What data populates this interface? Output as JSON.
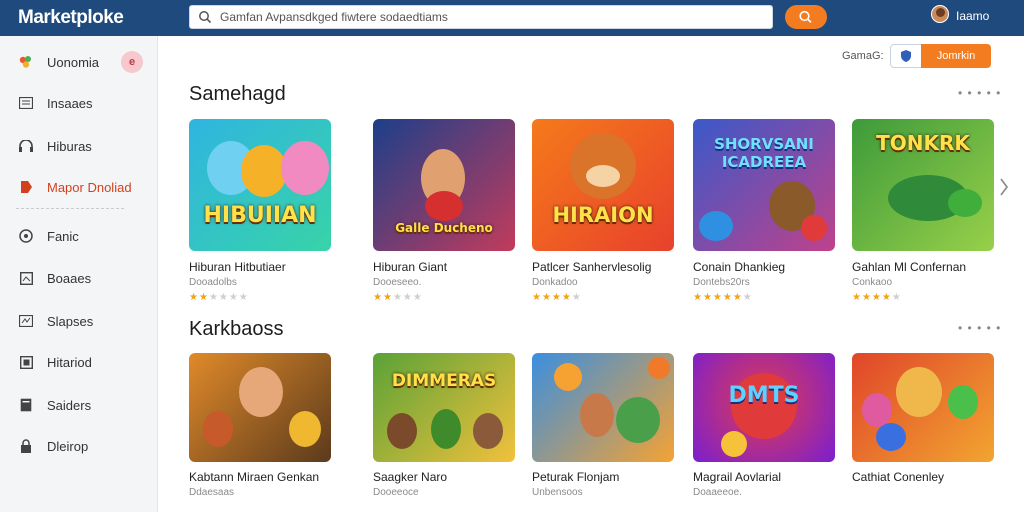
{
  "app": {
    "logo": "Marketploke"
  },
  "search": {
    "placeholder": "Gamfan Avpansdkged fiwtere sodaedtiams"
  },
  "user": {
    "name": "Iaamo"
  },
  "sidebar": {
    "items": [
      {
        "label": "Uonomia",
        "icon": "leaf-icon",
        "badge": "e"
      },
      {
        "label": "Insaaes",
        "icon": "list-icon"
      },
      {
        "label": "Hiburas",
        "icon": "headphones-icon"
      },
      {
        "label": "Mapor Dnoliad",
        "icon": "tag-icon",
        "active": true
      },
      {
        "label": "Fanic",
        "icon": "disc-icon"
      },
      {
        "label": "Boaaes",
        "icon": "box-icon"
      },
      {
        "label": "Slapses",
        "icon": "grid-icon"
      },
      {
        "label": "Hitariod",
        "icon": "square-icon"
      },
      {
        "label": "Saiders",
        "icon": "doc-icon"
      },
      {
        "label": "Dleirop",
        "icon": "lock-icon"
      }
    ]
  },
  "filter": {
    "label": "GamaG:",
    "button_label": "Jomrkin"
  },
  "sections": [
    {
      "title": "Samehagd",
      "cards": [
        {
          "title": "Hiburan Hitbutiaer",
          "subtitle": "Dooadolbs",
          "rating": 2,
          "thumb_text": "HIBUIIAN",
          "colors": [
            "#2fb5e0",
            "#38d3a8"
          ]
        },
        {
          "title": "Hiburan Giant",
          "subtitle": "Dooeseeo.",
          "rating": 2,
          "thumb_text": "Galle Ducheno",
          "colors": [
            "#1c3f8a",
            "#c23b5c"
          ]
        },
        {
          "title": "Patlcer Sanhervlesolig",
          "subtitle": "Donkadoo",
          "rating": 4,
          "thumb_text": "HIRAION",
          "colors": [
            "#f57a1b",
            "#e8412c"
          ]
        },
        {
          "title": "Conain Dhankieg",
          "subtitle": "Dontebs20rs",
          "rating": 5,
          "thumb_text": "SHORVSANI ICADREEA",
          "colors": [
            "#3a59c9",
            "#c0418a"
          ]
        },
        {
          "title": "Gahlan Ml Confernan",
          "subtitle": "Conkaoo",
          "rating": 4,
          "thumb_text": "TONKRK",
          "colors": [
            "#3d9a3a",
            "#98d04a"
          ]
        }
      ]
    },
    {
      "title": "Karkbaoss",
      "cards": [
        {
          "title": "Kabtann Miraen Genkan",
          "subtitle": "Ddaesaas",
          "thumb_text": "",
          "colors": [
            "#e08a2a",
            "#5b3a1c"
          ]
        },
        {
          "title": "Saagker Naro",
          "subtitle": "Dooeeoce",
          "thumb_text": "DIMMERAS",
          "colors": [
            "#5aa237",
            "#f2c13c"
          ]
        },
        {
          "title": "Peturak Flonjam",
          "subtitle": "Unbensoos",
          "thumb_text": "",
          "colors": [
            "#3a8fe0",
            "#f5a233"
          ]
        },
        {
          "title": "Magrail Aovlarial",
          "subtitle": "Doaaeeoe.",
          "thumb_text": "DMTS",
          "colors": [
            "#7a1fd0",
            "#e23b4f"
          ]
        },
        {
          "title": "Cathiat Conenley",
          "subtitle": "",
          "thumb_text": "",
          "colors": [
            "#e0452a",
            "#f2a530"
          ]
        }
      ]
    }
  ]
}
